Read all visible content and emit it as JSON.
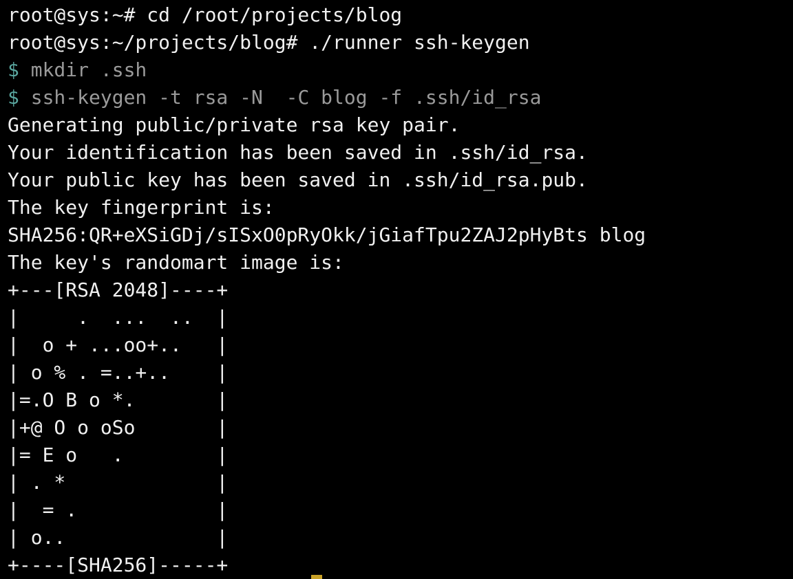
{
  "terminal": {
    "lines": [
      "root@sys:~# cd /root/projects/blog",
      "root@sys:~/projects/blog# ./runner ssh-keygen",
      "Generating public/private rsa key pair.",
      "Your identification has been saved in .ssh/id_rsa.",
      "Your public key has been saved in .ssh/id_rsa.pub.",
      "The key fingerprint is:",
      "SHA256:QR+eXSiGDj/sISxO0pRyOkk/jGiafTpu2ZAJ2pHyBts blog",
      "The key's randomart image is:"
    ],
    "runner_cmds": [
      {
        "sigil": "$",
        "text": " mkdir .ssh"
      },
      {
        "sigil": "$",
        "text": " ssh-keygen -t rsa -N  -C blog -f .ssh/id_rsa"
      }
    ],
    "randomart": [
      "+---[RSA 2048]----+",
      "|     .  ...  ..  |",
      "|  o + ...oo+..   |",
      "| o % . =..+..    |",
      "|=.O B o *.       |",
      "|+@ O o oSo       |",
      "|= E o   .        |",
      "| . *             |",
      "|  = .            |",
      "| o..             |",
      "+----[SHA256]-----+"
    ]
  },
  "colors": {
    "background": "#000000",
    "text": "#f0f0f0",
    "prompt_sigil": "#5aa7a0",
    "runner_cmd": "#9a9a9a",
    "cursor": "#c9a227"
  }
}
